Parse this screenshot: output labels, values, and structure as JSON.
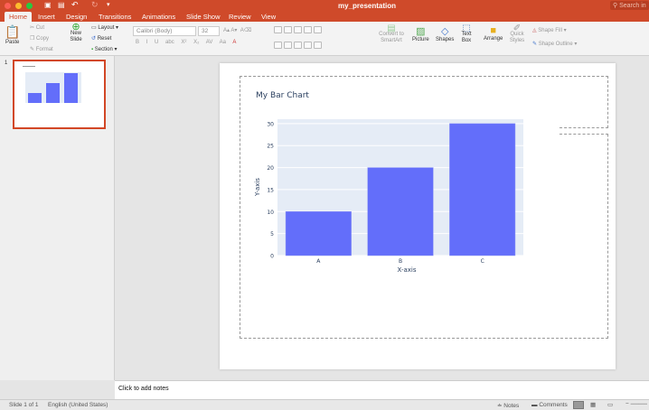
{
  "window": {
    "title": "my_presentation",
    "search_placeholder": "Search in"
  },
  "tabs": [
    {
      "label": "Home",
      "active": true
    },
    {
      "label": "Insert"
    },
    {
      "label": "Design"
    },
    {
      "label": "Transitions"
    },
    {
      "label": "Animations"
    },
    {
      "label": "Slide Show"
    },
    {
      "label": "Review"
    },
    {
      "label": "View"
    }
  ],
  "ribbon": {
    "paste": "Paste",
    "cut": "Cut",
    "copy": "Copy",
    "format": "Format",
    "new_slide": "New Slide",
    "layout": "Layout",
    "reset": "Reset",
    "section": "Section",
    "font": "Calibri (Body)",
    "size": "32",
    "convert": "Convert to SmartArt",
    "picture": "Picture",
    "shapes": "Shapes",
    "textbox": "Text Box",
    "arrange": "Arrange",
    "quick_styles": "Quick Styles",
    "shape_fill": "Shape Fill",
    "shape_outline": "Shape Outline",
    "format_buttons": [
      "B",
      "I",
      "U",
      "abc",
      "X²",
      "X₂"
    ]
  },
  "thumbnail": {
    "number": "1"
  },
  "notes": {
    "placeholder": "Click to add notes"
  },
  "status": {
    "slide": "Slide 1 of 1",
    "language": "English (United States)",
    "notes": "Notes",
    "comments": "Comments"
  },
  "colors": {
    "accent": "#cf4a2a",
    "bar": "#636efa",
    "plot_bg": "#e5ecf6"
  },
  "chart_data": {
    "type": "bar",
    "title": "My Bar Chart",
    "xlabel": "X-axis",
    "ylabel": "Y-axis",
    "categories": [
      "A",
      "B",
      "C"
    ],
    "values": [
      10,
      20,
      30
    ],
    "ylim": [
      0,
      31
    ],
    "yticks": [
      0,
      5,
      10,
      15,
      20,
      25,
      30
    ],
    "grid": true
  }
}
